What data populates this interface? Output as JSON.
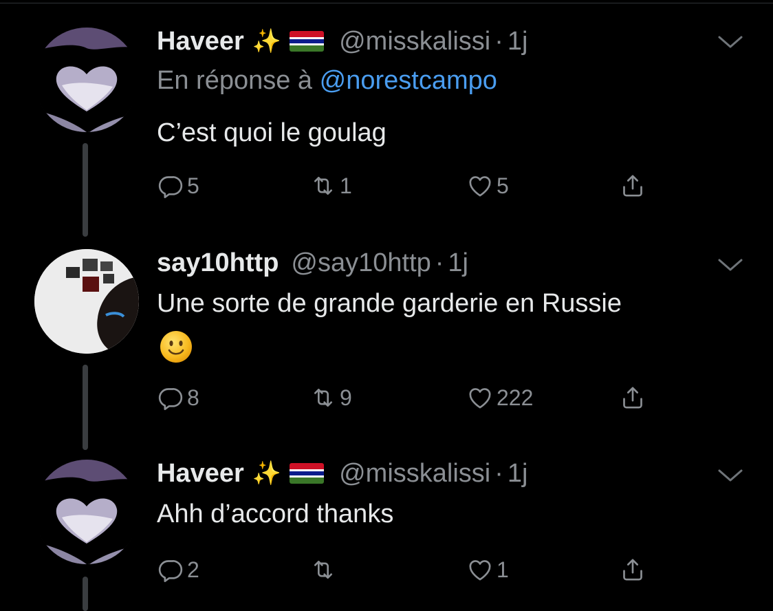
{
  "tweets": [
    {
      "name": "Haveer",
      "sparkles": "✨",
      "handle": "@misskalissi",
      "dot": "·",
      "time": "1j",
      "reply_prefix": "En réponse à",
      "reply_to": "@norestcampo",
      "text": "C’est quoi le goulag",
      "counts": {
        "reply": "5",
        "retweet": "1",
        "like": "5"
      }
    },
    {
      "name": "say10http",
      "handle": "@say10http",
      "dot": "·",
      "time": "1j",
      "text": "Une sorte de grande garderie en Russie",
      "emoji": "slightly-smiling-face",
      "counts": {
        "reply": "8",
        "retweet": "9",
        "like": "222"
      }
    },
    {
      "name": "Haveer",
      "sparkles": "✨",
      "handle": "@misskalissi",
      "dot": "·",
      "time": "1j",
      "text": "Ahh d’accord thanks",
      "counts": {
        "reply": "2",
        "retweet": "",
        "like": "1"
      }
    }
  ],
  "colors": {
    "background": "#000000",
    "name": "#e7e9ea",
    "secondary": "#8b8f94",
    "link": "#4a9df0",
    "thread_line": "#3a3d40"
  },
  "icons": [
    "sparkles-icon",
    "gambia-flag-icon",
    "chevron-down-icon",
    "reply-icon",
    "retweet-icon",
    "like-icon",
    "share-icon"
  ]
}
